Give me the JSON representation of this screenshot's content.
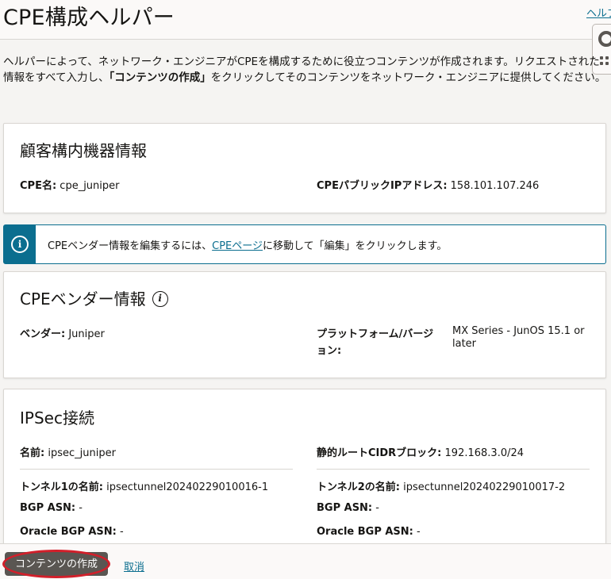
{
  "header": {
    "title": "CPE構成ヘルパー",
    "help_link": "ヘルプ"
  },
  "intro": {
    "part1": "ヘルパーによって、ネットワーク・エンジニアがCPEを構成するために役立つコンテンツが作成されます。リクエストされた情報をすべて入力し、",
    "bold": "「コンテンツの作成」",
    "part2": "をクリックしてそのコンテンツをネットワーク・エンジニアに提供してください。"
  },
  "cpe_info": {
    "title": "顧客構内機器情報",
    "name_label": "CPE名:",
    "name_value": "cpe_juniper",
    "ip_label": "CPEパブリックIPアドレス:",
    "ip_value": "158.101.107.246"
  },
  "banner": {
    "before": "CPEベンダー情報を編集するには、",
    "link": "CPEページ",
    "after": "に移動して「編集」をクリックします。"
  },
  "vendor_info": {
    "title": "CPEベンダー情報",
    "vendor_label": "ベンダー:",
    "vendor_value": "Juniper",
    "platform_label_1": "プラットフォーム/バージ",
    "platform_label_2": "ョン:",
    "platform_value_1": "MX Series - JunOS 15.1 or",
    "platform_value_2": "later"
  },
  "ipsec": {
    "title": "IPSec接続",
    "name_label": "名前:",
    "name_value": "ipsec_juniper",
    "cidr_label": "静的ルートCIDRブロック:",
    "cidr_value": "192.168.3.0/24",
    "tunnel1": {
      "label": "トンネル1の名前:",
      "value": "ipsectunnel20240229010016-1",
      "bgp_label": "BGP ASN:",
      "bgp_value": "-",
      "oracle_label": "Oracle BGP ASN:",
      "oracle_value": "-"
    },
    "tunnel2": {
      "label": "トンネル2の名前:",
      "value": "ipsectunnel20240229010017-2",
      "bgp_label": "BGP ASN:",
      "bgp_value": "-",
      "oracle_label": "Oracle BGP ASN:",
      "oracle_value": "-"
    }
  },
  "footer": {
    "create_button": "コンテンツの作成",
    "cancel_link": "取消"
  },
  "icons": {
    "info": "info-icon",
    "help_float": "lifebuoy-icon",
    "drag": "grip-icon"
  },
  "colors": {
    "accent": "#0b6e8f",
    "primary_button": "#5a5652",
    "highlight_ring": "#d21f2a"
  }
}
